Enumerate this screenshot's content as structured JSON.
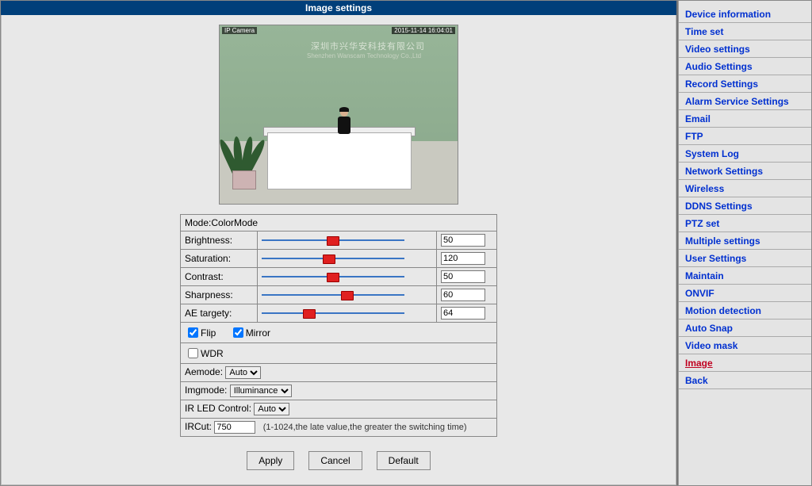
{
  "title": "Image settings",
  "camera_label": "IP Camera",
  "timestamp": "2015-11-14 16:04:01",
  "wall_text_cn": "深圳市兴华安科技有限公司",
  "wall_text_en": "Shenzhen Wanscam Technology Co.,Ltd",
  "mode_label": "Mode:ColorMode",
  "sliders": {
    "brightness": {
      "label": "Brightness:",
      "value": "50",
      "pos": 50
    },
    "saturation": {
      "label": "Saturation:",
      "value": "120",
      "pos": 47
    },
    "contrast": {
      "label": "Contrast:",
      "value": "50",
      "pos": 50
    },
    "sharpness": {
      "label": "Sharpness:",
      "value": "60",
      "pos": 60
    },
    "ae": {
      "label": "AE targety:",
      "value": "64",
      "pos": 33
    }
  },
  "flip_label": "Flip",
  "mirror_label": "Mirror",
  "wdr_label": "WDR",
  "aemode": {
    "label": "Aemode:",
    "value": "Auto"
  },
  "imgmode": {
    "label": "Imgmode:",
    "value": "Illuminance"
  },
  "irled": {
    "label": "IR LED Control:",
    "value": "Auto"
  },
  "ircut": {
    "label": "IRCut:",
    "value": "750",
    "hint": "(1-1024,the late value,the greater the switching time)"
  },
  "buttons": {
    "apply": "Apply",
    "cancel": "Cancel",
    "default": "Default"
  },
  "sidebar": [
    {
      "label": "Device information"
    },
    {
      "label": "Time set"
    },
    {
      "label": "Video settings"
    },
    {
      "label": "Audio Settings"
    },
    {
      "label": "Record Settings"
    },
    {
      "label": "Alarm Service Settings"
    },
    {
      "label": "Email"
    },
    {
      "label": "FTP"
    },
    {
      "label": "System Log"
    },
    {
      "label": "Network Settings"
    },
    {
      "label": "Wireless"
    },
    {
      "label": "DDNS Settings"
    },
    {
      "label": "PTZ set"
    },
    {
      "label": "Multiple settings"
    },
    {
      "label": "User Settings"
    },
    {
      "label": "Maintain"
    },
    {
      "label": "ONVIF"
    },
    {
      "label": "Motion detection"
    },
    {
      "label": "Auto Snap"
    },
    {
      "label": "Video mask"
    },
    {
      "label": "Image"
    },
    {
      "label": "Back"
    }
  ],
  "sidebar_active_index": 20
}
